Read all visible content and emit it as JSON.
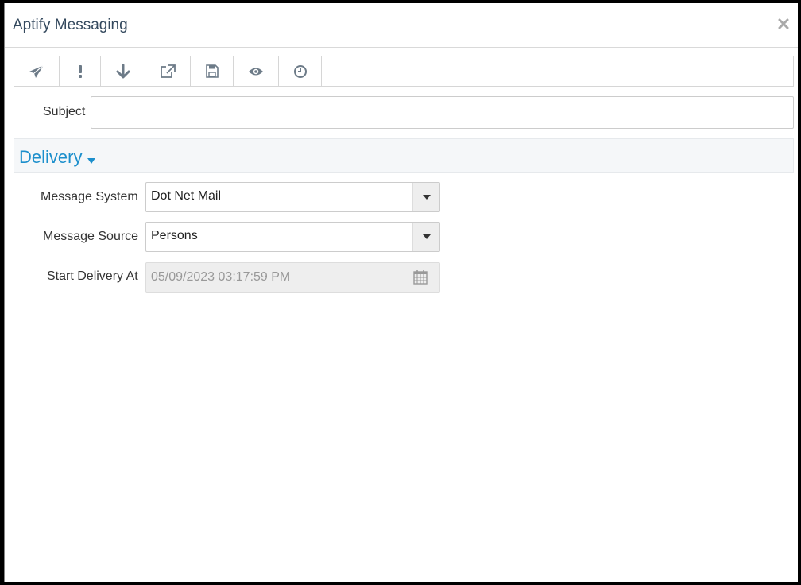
{
  "window": {
    "title": "Aptify Messaging",
    "close_icon": "close-icon"
  },
  "toolbar": {
    "buttons": [
      {
        "name": "send",
        "icon": "paper-plane-icon"
      },
      {
        "name": "priority",
        "icon": "exclamation-icon"
      },
      {
        "name": "download",
        "icon": "arrow-down-icon"
      },
      {
        "name": "open-external",
        "icon": "external-link-icon"
      },
      {
        "name": "save",
        "icon": "floppy-disk-icon"
      },
      {
        "name": "preview",
        "icon": "eye-icon"
      },
      {
        "name": "schedule",
        "icon": "clock-icon"
      }
    ]
  },
  "subject": {
    "label": "Subject",
    "value": "",
    "placeholder": ""
  },
  "delivery": {
    "section_title": "Delivery",
    "message_system": {
      "label": "Message System",
      "value": "Dot Net Mail"
    },
    "message_source": {
      "label": "Message Source",
      "value": "Persons"
    },
    "start_delivery": {
      "label": "Start Delivery At",
      "value": "05/09/2023 03:17:59 PM"
    }
  },
  "colors": {
    "accent": "#1c8fcc",
    "icon": "#6d7b88",
    "section_bg": "#f5f7f9"
  }
}
